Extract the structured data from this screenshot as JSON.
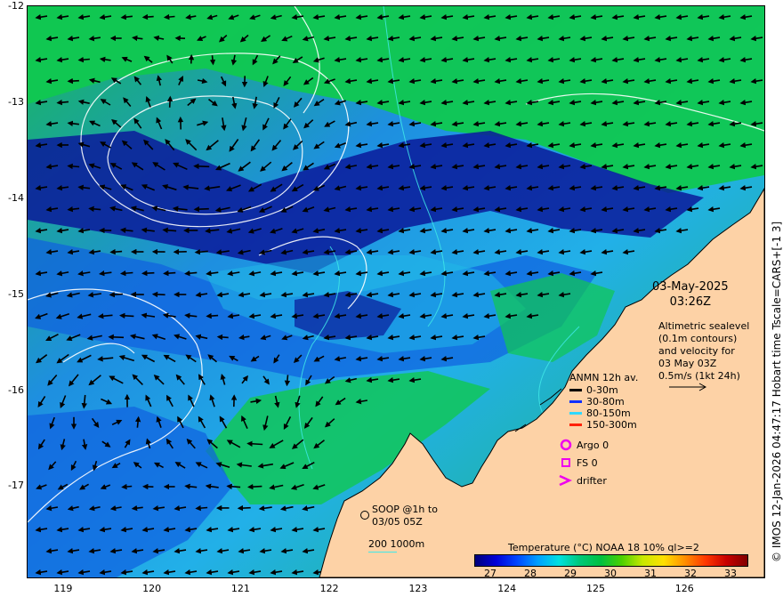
{
  "map": {
    "x_ticks": [
      "119",
      "120",
      "121",
      "122",
      "123",
      "124",
      "125",
      "126"
    ],
    "y_ticks": [
      "-12",
      "-13",
      "-14",
      "-15",
      "-16",
      "-17"
    ],
    "lon_range": [
      118.6,
      126.9
    ],
    "lat_range": [
      -12,
      -17.95
    ],
    "colors": {
      "land": "#fdd2a6",
      "coast": "#000000",
      "sea_deep_blue": "#0a1a9a",
      "sea_blue": "#1060e0",
      "sea_cyan": "#20b8e8",
      "sea_green": "#10c850",
      "contour": "#ffffff",
      "bathy_contour": "#40e8e8"
    }
  },
  "annotation": {
    "date": "03-May-2025",
    "time": "03:26Z",
    "altimetry_lines": [
      "Altimetric sealevel",
      "(0.1m contours)",
      "and velocity for",
      "03 May 03Z",
      "0.5m/s (1kt 24h)"
    ]
  },
  "legend": {
    "title": "ANMN 12h av.",
    "items": [
      {
        "label": "0-30m",
        "color": "#000000"
      },
      {
        "label": "30-80m",
        "color": "#1030ff"
      },
      {
        "label": "80-150m",
        "color": "#30d8ff"
      },
      {
        "label": "150-300m",
        "color": "#ff2000"
      }
    ]
  },
  "markers": {
    "argo": {
      "label": "Argo 0",
      "color": "#ee00ee"
    },
    "fs": {
      "label": "FS 0",
      "color": "#ee00ee"
    },
    "drifter": {
      "label": "drifter",
      "color": "#ee00ee"
    }
  },
  "soop": {
    "lines": [
      "SOOP @1h to",
      "03/05 05Z"
    ]
  },
  "contour_key": {
    "label": "200 1000m"
  },
  "colorbar": {
    "title": "Temperature (°C) NOAA 18 10% ql>=2",
    "ticks": [
      "27",
      "28",
      "29",
      "30",
      "31",
      "32",
      "33"
    ],
    "range": [
      26.6,
      33.4
    ]
  },
  "credit": "© IMOS 12-Jan-2026 04:47:17 Hobart time Tscale=CARS+[-1 3]"
}
